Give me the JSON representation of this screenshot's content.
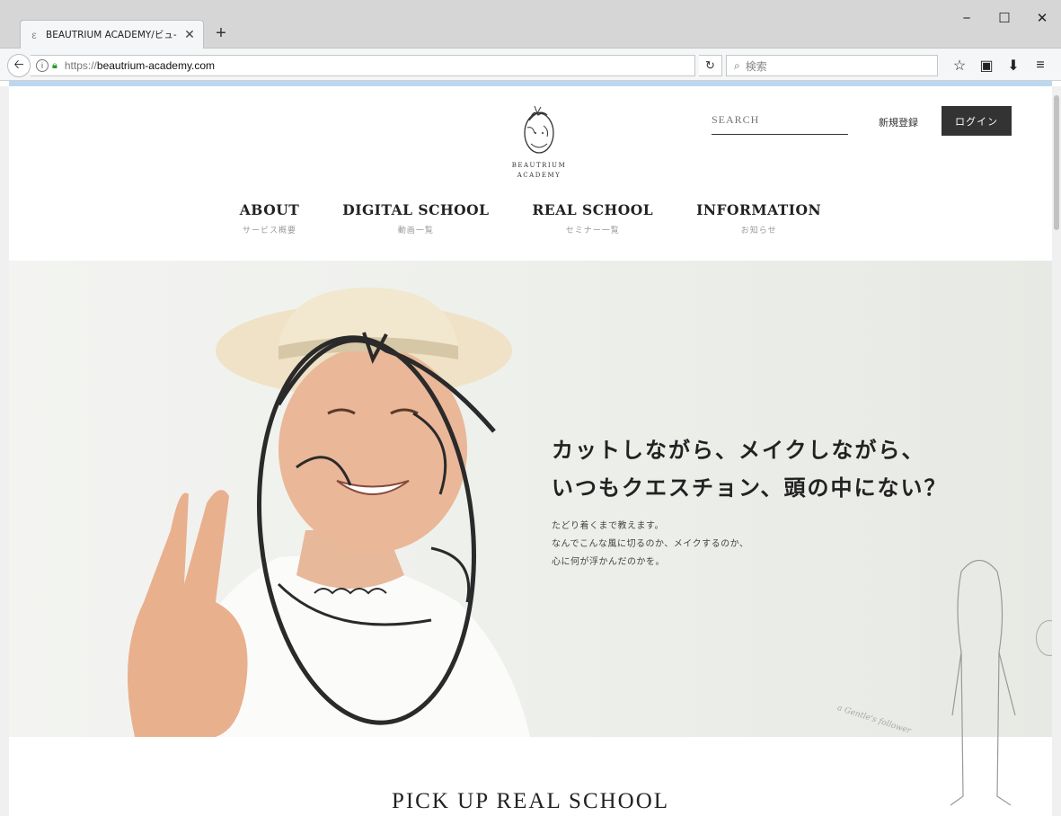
{
  "browser": {
    "tab_title": "BEAUTRIUM ACADEMY/ビュ-",
    "tab_close": "✕",
    "new_tab": "+",
    "window_controls": [
      "−",
      "☐",
      "✕"
    ],
    "url_protocol": "https://",
    "url_host": "beautrium-academy.com",
    "search_placeholder": "検索",
    "icons": [
      "back-arrow-icon",
      "info-icon",
      "lock-icon",
      "reload-icon",
      "search-icon",
      "bookmark-star-icon",
      "reading-list-icon",
      "download-icon",
      "menu-icon"
    ]
  },
  "site": {
    "logo_line1": "BEAUTRIUM",
    "logo_line2": "ACADEMY",
    "search_placeholder": "SEARCH",
    "register_label": "新規登録",
    "login_label": "ログイン",
    "nav": [
      {
        "title": "ABOUT",
        "sub": "サービス概要"
      },
      {
        "title": "DIGITAL SCHOOL",
        "sub": "動画一覧"
      },
      {
        "title": "REAL SCHOOL",
        "sub": "セミナー一覧"
      },
      {
        "title": "INFORMATION",
        "sub": "お知らせ"
      }
    ]
  },
  "hero": {
    "heading_line1": "カットしながら、メイクしながら、",
    "heading_line2": "いつもクエスチョン、頭の中にない？",
    "body_line1": "たどり着くまで教えます。",
    "body_line2": "なんでこんな風に切るのか、メイクするのか、",
    "body_line3": "心に何が浮かんだのかを。",
    "deco_script": "a Gentle's follower"
  },
  "pickup": {
    "title": "PICK UP REAL SCHOOL"
  },
  "colors": {
    "login_bg": "#333333",
    "hero_bg": "#eef0ec",
    "accent_strip": "#bcd7f2"
  }
}
